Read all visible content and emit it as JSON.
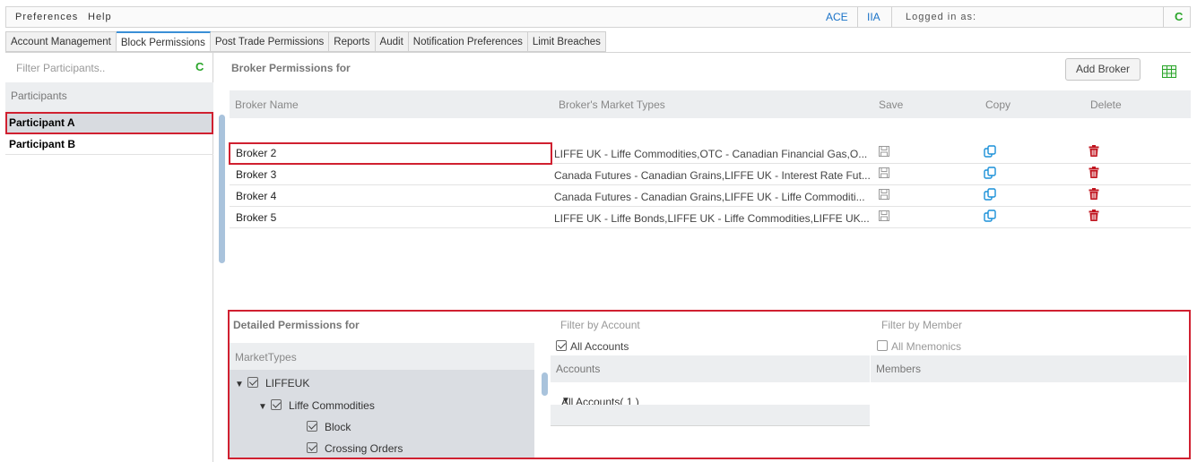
{
  "menubar": {
    "preferences": "Preferences",
    "help": "Help",
    "env1": "ACE",
    "env2": "IIA",
    "logged_in": "Logged in as:",
    "refresh": "C"
  },
  "tabs": [
    "Account Management",
    "Block Permissions",
    "Post Trade Permissions",
    "Reports",
    "Audit",
    "Notification Preferences",
    "Limit Breaches"
  ],
  "left": {
    "filter_placeholder": "Filter Participants..",
    "refresh": "C",
    "header": "Participants",
    "participants": [
      "Participant A",
      "Participant B"
    ]
  },
  "broker": {
    "title": "Broker Permissions for",
    "add_button": "Add Broker",
    "columns": {
      "name": "Broker Name",
      "types": "Broker's Market Types",
      "save": "Save",
      "copy": "Copy",
      "delete": "Delete"
    },
    "rows": [
      {
        "name": "Broker 2",
        "types": "LIFFE UK - Liffe Commodities,OTC - Canadian Financial Gas,O..."
      },
      {
        "name": "Broker 3",
        "types": "Canada Futures - Canadian Grains,LIFFE UK - Interest Rate Fut..."
      },
      {
        "name": "Broker 4",
        "types": "Canada Futures - Canadian Grains,LIFFE UK - Liffe Commoditi..."
      },
      {
        "name": "Broker 5",
        "types": "LIFFE UK - Liffe Bonds,LIFFE UK - Liffe Commodities,LIFFE UK..."
      }
    ]
  },
  "detail": {
    "title": "Detailed Permissions for",
    "filter_account": "Filter by Account",
    "filter_member": "Filter by Member",
    "all_accounts": "All Accounts",
    "all_mnemonics": "All Mnemonics",
    "market_types_header": "MarketTypes",
    "accounts_header": "Accounts",
    "members_header": "Members",
    "tree": [
      {
        "label": "LIFFEUK",
        "checked": true
      },
      {
        "label": "Liffe Commodities",
        "checked": true
      },
      {
        "label": "Block",
        "checked": true
      },
      {
        "label": "Crossing Orders",
        "checked": true
      }
    ],
    "accounts_row": "All Accounts( 1 )"
  },
  "colors": {
    "accent_blue": "#1a73c8",
    "highlight_red": "#d02030",
    "delete_red": "#c0141e",
    "refresh_green": "#2aa52a",
    "grid_green": "#2aa52a"
  }
}
